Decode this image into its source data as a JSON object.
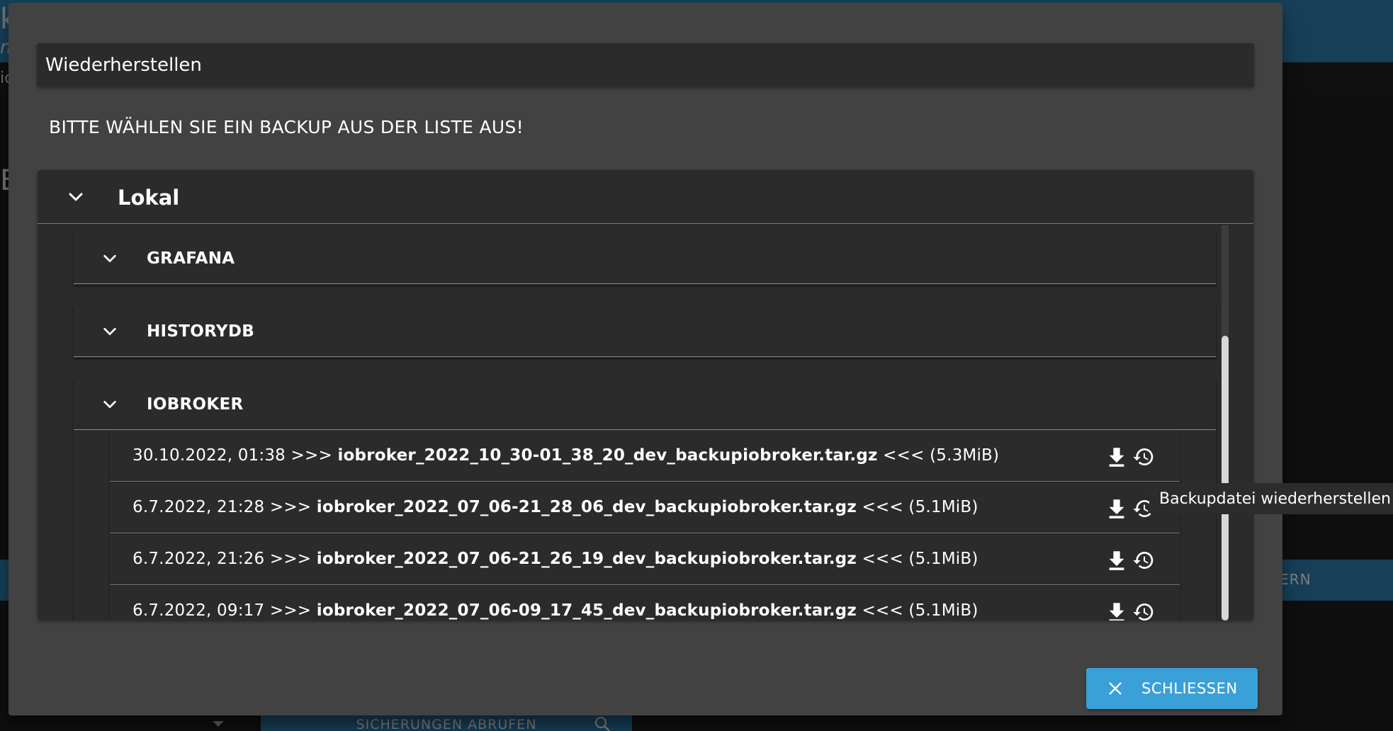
{
  "background": {
    "right_band_text": "HERN",
    "left_chars": [
      "k",
      "m",
      "ic",
      "E"
    ],
    "fetch_button_label": "SICHERUNGEN ABRUFEN"
  },
  "dialog": {
    "title": "Wiederherstellen",
    "subtitle": "BITTE WÄHLEN SIE EIN BACKUP AUS DER LISTE AUS!",
    "group": {
      "label": "Lokal",
      "sections": [
        {
          "label": "GRAFANA"
        },
        {
          "label": "HISTORYDB"
        },
        {
          "label": "IOBROKER"
        }
      ],
      "files": [
        {
          "date": "30.10.2022, 01:38",
          "prefix": ">>>",
          "filename": "iobroker_2022_10_30-01_38_20_dev_backupiobroker.tar.gz",
          "suffix": "<<<",
          "size": "(5.3MiB)"
        },
        {
          "date": "6.7.2022, 21:28",
          "prefix": ">>>",
          "filename": "iobroker_2022_07_06-21_28_06_dev_backupiobroker.tar.gz",
          "suffix": "<<<",
          "size": "(5.1MiB)"
        },
        {
          "date": "6.7.2022, 21:26",
          "prefix": ">>>",
          "filename": "iobroker_2022_07_06-21_26_19_dev_backupiobroker.tar.gz",
          "suffix": "<<<",
          "size": "(5.1MiB)"
        },
        {
          "date": "6.7.2022, 09:17",
          "prefix": ">>>",
          "filename": "iobroker_2022_07_06-09_17_45_dev_backupiobroker.tar.gz",
          "suffix": "<<<",
          "size": "(5.1MiB)"
        }
      ]
    },
    "tooltip": "Backupdatei wiederherstellen",
    "close_label": "SCHLIESSEN"
  },
  "icons": {
    "expand": "chevron-down-icon",
    "download": "download-icon",
    "restore": "restore-history-icon",
    "close": "close-icon",
    "search": "search-icon"
  },
  "colors": {
    "dialog_bg": "#424242",
    "panel_bg": "#2b2b2b",
    "accent": "#3aa0d8",
    "app_bar": "#2f7fb0"
  }
}
